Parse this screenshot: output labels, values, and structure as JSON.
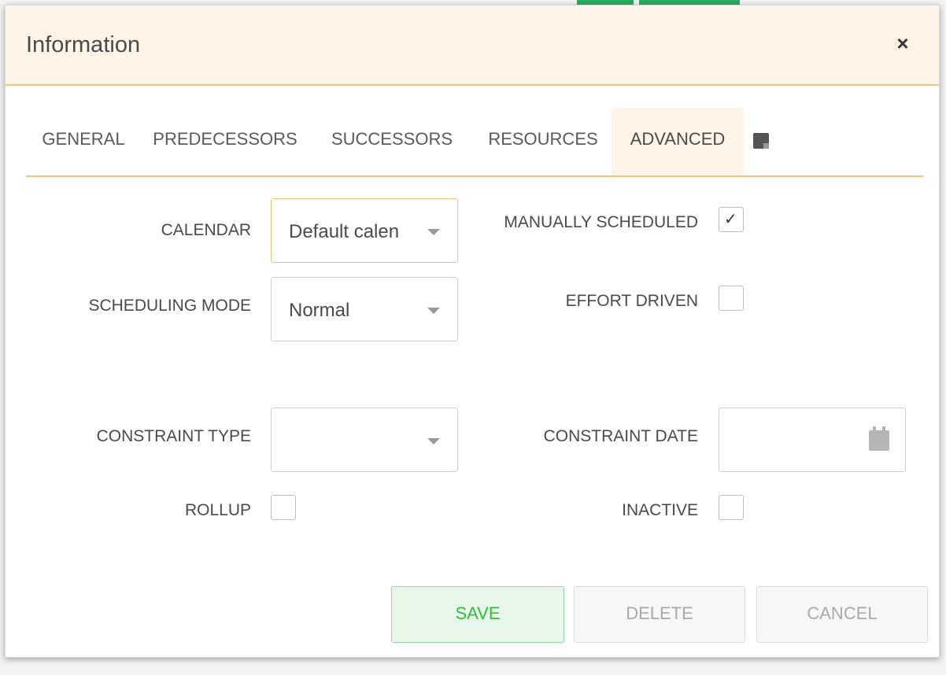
{
  "dialog": {
    "title": "Information",
    "close_glyph": "×"
  },
  "tabs": [
    {
      "label": "GENERAL",
      "active": false
    },
    {
      "label": "PREDECESSORS",
      "active": false
    },
    {
      "label": "SUCCESSORS",
      "active": false
    },
    {
      "label": "RESOURCES",
      "active": false
    },
    {
      "label": "ADVANCED",
      "active": true
    },
    {
      "label": "",
      "icon": "note-icon",
      "active": false
    }
  ],
  "form": {
    "calendar": {
      "label": "CALENDAR",
      "value": "Default calen"
    },
    "scheduling_mode": {
      "label": "SCHEDULING MODE",
      "value": "Normal"
    },
    "constraint_type": {
      "label": "CONSTRAINT TYPE",
      "value": ""
    },
    "rollup": {
      "label": "ROLLUP",
      "checked": false
    },
    "manually_scheduled": {
      "label": "MANUALLY SCHEDULED",
      "checked": true
    },
    "effort_driven": {
      "label": "EFFORT DRIVEN",
      "checked": false
    },
    "constraint_date": {
      "label": "CONSTRAINT DATE",
      "value": "",
      "icon": "calendar-icon"
    },
    "inactive": {
      "label": "INACTIVE",
      "checked": false
    }
  },
  "buttons": {
    "save": "SAVE",
    "delete": "DELETE",
    "cancel": "CANCEL"
  },
  "colors": {
    "header_bg": "#fef5e8",
    "accent": "#f5c376",
    "save_text": "#2ec03d"
  }
}
